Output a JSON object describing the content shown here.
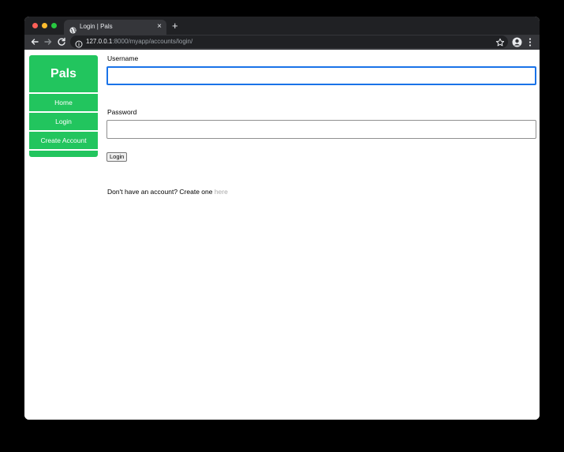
{
  "browser": {
    "tab": {
      "title": "Login | Pals"
    },
    "tab_close_symbol": "×",
    "new_tab_symbol": "+",
    "address_bar": {
      "host": "127.0.0.1",
      "rest": ":8000/myapp/accounts/login/"
    },
    "icons": {
      "favicon": "globe-icon",
      "back": "arrow-left-icon",
      "forward": "arrow-right-icon",
      "reload": "reload-icon",
      "site_info": "info-icon",
      "bookmark": "star-icon",
      "profile": "profile-icon",
      "menu": "kebab-menu-icon"
    }
  },
  "sidebar": {
    "brand": "Pals",
    "items": [
      {
        "label": "Home"
      },
      {
        "label": "Login"
      },
      {
        "label": "Create Account"
      }
    ]
  },
  "form": {
    "username_label": "Username",
    "username_value": "",
    "password_label": "Password",
    "password_value": "",
    "submit_label": "Login"
  },
  "signup": {
    "prompt": "Don't have an account? Create one ",
    "link_text": "here"
  },
  "colors": {
    "sidebar": "#22c55e",
    "focus_ring": "#1a73e8",
    "link": "#a8a8a8",
    "chrome_dark": "#202124",
    "chrome_toolbar": "#35363a"
  }
}
